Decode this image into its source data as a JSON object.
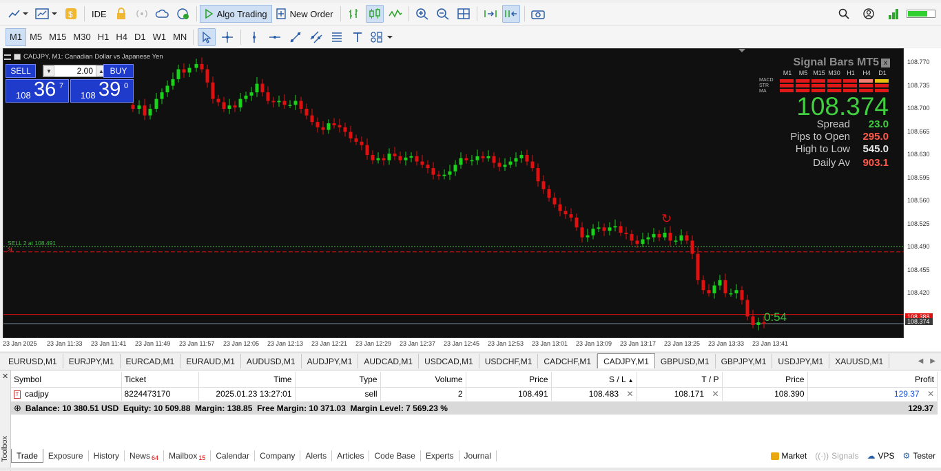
{
  "toolbar1": {
    "ide_label": "IDE",
    "algo_label": "Algo Trading",
    "neworder_label": "New Order"
  },
  "timeframes": [
    "M1",
    "M5",
    "M15",
    "M30",
    "H1",
    "H4",
    "D1",
    "W1",
    "MN"
  ],
  "chart": {
    "title": "CADJPY, M1:  Canadian Dollar vs Japanese Yen",
    "y_ticks": [
      "108.770",
      "108.735",
      "108.700",
      "108.665",
      "108.630",
      "108.595",
      "108.560",
      "108.525",
      "108.490",
      "108.455",
      "108.420"
    ],
    "x_ticks": [
      "23 Jan 2025",
      "23 Jan 11:33",
      "23 Jan 11:41",
      "23 Jan 11:49",
      "23 Jan 11:57",
      "23 Jan 12:05",
      "23 Jan 12:13",
      "23 Jan 12:21",
      "23 Jan 12:29",
      "23 Jan 12:37",
      "23 Jan 12:45",
      "23 Jan 12:53",
      "23 Jan 13:01",
      "23 Jan 13:09",
      "23 Jan 13:17",
      "23 Jan 13:25",
      "23 Jan 13:33",
      "23 Jan 13:41"
    ],
    "sell_line_label": "SELL 2 at 108.491",
    "sl_label": "SL",
    "timer": "0:54",
    "ask_tag": "108.388",
    "bid_tag": "108.374",
    "colors": {
      "bull": "#19d219",
      "bear": "#e01010",
      "background": "#101010"
    }
  },
  "trade_panel": {
    "sell_label": "SELL",
    "buy_label": "BUY",
    "volume": "2.00",
    "sell_small": "108",
    "sell_big": "36",
    "sell_sup": "7",
    "buy_small": "108",
    "buy_big": "39",
    "buy_sup": "0"
  },
  "signal_bars": {
    "title": "Signal Bars MT5",
    "close": "x",
    "timeframes": [
      "M1",
      "M5",
      "M15",
      "M30",
      "H1",
      "H4",
      "D1"
    ],
    "indicators": [
      "MACD",
      "STR",
      "MA"
    ],
    "price": "108.374",
    "rows": [
      {
        "label": "Spread",
        "value": "23.0",
        "color": "#3fcf3f"
      },
      {
        "label": "Pips to Open",
        "value": "295.0",
        "color": "#ff5a4a"
      },
      {
        "label": "High to Low",
        "value": "545.0",
        "color": "#e8e8e8"
      },
      {
        "label": "Daily Av",
        "value": "903.1",
        "color": "#ff5a4a"
      }
    ]
  },
  "symbol_tabs": [
    "EURUSD,M1",
    "EURJPY,M1",
    "EURCAD,M1",
    "EURAUD,M1",
    "AUDUSD,M1",
    "AUDJPY,M1",
    "AUDCAD,M1",
    "USDCAD,M1",
    "USDCHF,M1",
    "CADCHF,M1",
    "CADJPY,M1",
    "GBPUSD,M1",
    "GBPJPY,M1",
    "USDJPY,M1",
    "XAUUSD,M1"
  ],
  "table": {
    "headers": [
      "Symbol",
      "Ticket",
      "Time",
      "Type",
      "Volume",
      "Price",
      "S / L",
      "T / P",
      "Price",
      "Profit"
    ],
    "row": {
      "symbol": "cadjpy",
      "ticket": "8224473170",
      "time": "2025.01.23 13:27:01",
      "type": "sell",
      "volume": "2",
      "price": "108.491",
      "sl": "108.483",
      "tp": "108.171",
      "cur_price": "108.390",
      "profit": "129.37"
    },
    "balance_line": "Balance: 10 380.51 USD  Equity: 10 509.88  Margin: 138.85  Free Margin: 10 371.03  Margin Level: 7 569.23 %",
    "total_profit": "129.37"
  },
  "toolbox": {
    "side_label": "Toolbox",
    "tabs": [
      {
        "label": "Trade",
        "badge": ""
      },
      {
        "label": "Exposure",
        "badge": ""
      },
      {
        "label": "History",
        "badge": ""
      },
      {
        "label": "News",
        "badge": "64"
      },
      {
        "label": "Mailbox",
        "badge": "15"
      },
      {
        "label": "Calendar",
        "badge": ""
      },
      {
        "label": "Company",
        "badge": ""
      },
      {
        "label": "Alerts",
        "badge": ""
      },
      {
        "label": "Articles",
        "badge": ""
      },
      {
        "label": "Code Base",
        "badge": ""
      },
      {
        "label": "Experts",
        "badge": ""
      },
      {
        "label": "Journal",
        "badge": ""
      }
    ],
    "right": {
      "market": "Market",
      "signals": "Signals",
      "vps": "VPS",
      "tester": "Tester"
    }
  }
}
